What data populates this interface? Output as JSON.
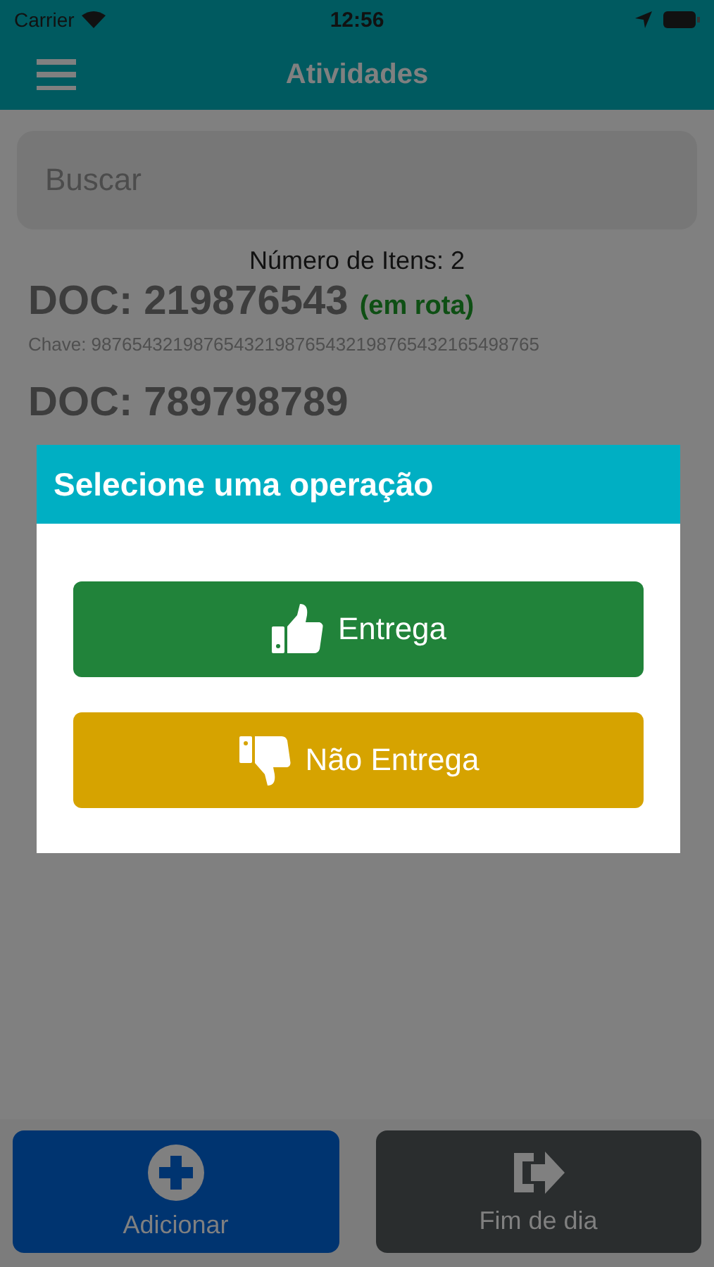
{
  "status_bar": {
    "carrier": "Carrier",
    "time": "12:56"
  },
  "header": {
    "title": "Atividades"
  },
  "search": {
    "placeholder": "Buscar"
  },
  "item_count": "Número de Itens: 2",
  "documents": [
    {
      "doc": "DOC: 219876543",
      "status": "(em rota)",
      "key": "Chave: 98765432198765432198765432198765432165498765"
    },
    {
      "doc": "DOC: 789798789"
    }
  ],
  "dialog": {
    "title": "Selecione uma operação",
    "options": [
      {
        "label": "Entrega",
        "kind": "deliver"
      },
      {
        "label": "Não Entrega",
        "kind": "not_deliver"
      }
    ]
  },
  "footer": [
    {
      "label": "Adicionar",
      "kind": "add"
    },
    {
      "label": "Fim de dia",
      "kind": "exit"
    }
  ]
}
